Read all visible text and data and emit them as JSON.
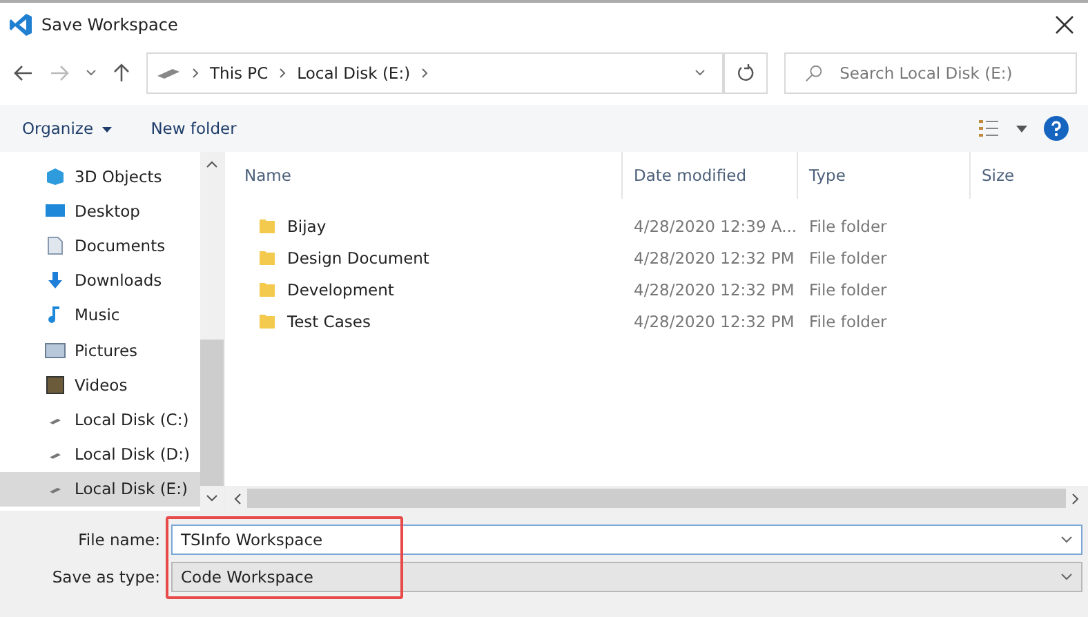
{
  "window": {
    "title": "Save Workspace"
  },
  "address": {
    "crumbs": [
      "This PC",
      "Local Disk (E:)"
    ]
  },
  "search": {
    "placeholder": "Search Local Disk (E:)"
  },
  "toolbar": {
    "organize": "Organize",
    "new_folder": "New folder"
  },
  "sidebar": {
    "items": [
      {
        "label": "3D Objects",
        "kind": "cube",
        "selected": false
      },
      {
        "label": "Desktop",
        "kind": "desktop",
        "selected": false
      },
      {
        "label": "Documents",
        "kind": "document",
        "selected": false
      },
      {
        "label": "Downloads",
        "kind": "download",
        "selected": false
      },
      {
        "label": "Music",
        "kind": "music",
        "selected": false
      },
      {
        "label": "Pictures",
        "kind": "picture",
        "selected": false
      },
      {
        "label": "Videos",
        "kind": "video",
        "selected": false
      },
      {
        "label": "Local Disk (C:)",
        "kind": "drive",
        "selected": false
      },
      {
        "label": "Local Disk (D:)",
        "kind": "drive",
        "selected": false
      },
      {
        "label": "Local Disk (E:)",
        "kind": "drive",
        "selected": true
      }
    ]
  },
  "table": {
    "columns": [
      "Name",
      "Date modified",
      "Type",
      "Size"
    ],
    "rows": [
      {
        "name": "Bijay",
        "date": "4/28/2020 12:39 A...",
        "type": "File folder"
      },
      {
        "name": "Design Document",
        "date": "4/28/2020 12:32 PM",
        "type": "File folder"
      },
      {
        "name": "Development",
        "date": "4/28/2020 12:32 PM",
        "type": "File folder"
      },
      {
        "name": "Test Cases",
        "date": "4/28/2020 12:32 PM",
        "type": "File folder"
      }
    ]
  },
  "form": {
    "file_name_label": "File name:",
    "file_name": "TSInfo Workspace",
    "type_label": "Save as type:",
    "type": "Code Workspace"
  }
}
